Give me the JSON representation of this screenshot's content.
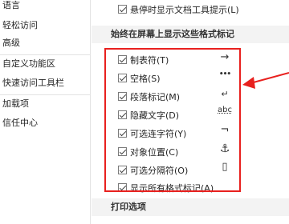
{
  "sidebar": {
    "items": [
      {
        "label": "语言"
      },
      {
        "label": "轻松访问"
      },
      {
        "label": "高级"
      },
      {
        "label": "自定义功能区"
      },
      {
        "label": "快速访问工具栏"
      },
      {
        "label": "加载项"
      },
      {
        "label": "信任中心"
      }
    ]
  },
  "main": {
    "top_option": {
      "label": "悬停时显示文档工具提示(L)",
      "checked": true
    },
    "formatting_section": {
      "title": "始终在屏幕上显示这些格式标记",
      "options": [
        {
          "label": "制表符(T)",
          "checked": true,
          "symbol": "→"
        },
        {
          "label": "空格(S)",
          "checked": true,
          "symbol": "•••"
        },
        {
          "label": "段落标记(M)",
          "checked": true,
          "symbol": "↵"
        },
        {
          "label": "隐藏文字(D)",
          "checked": true,
          "symbol": "abc"
        },
        {
          "label": "可选连字符(Y)",
          "checked": true,
          "symbol": "¬"
        },
        {
          "label": "对象位置(C)",
          "checked": true,
          "symbol": "⚓"
        },
        {
          "label": "可选分隔符(O)",
          "checked": true,
          "symbol": "▯"
        },
        {
          "label": "显示所有格式标记(A)",
          "checked": true,
          "symbol": ""
        }
      ]
    },
    "print_section": {
      "title": "打印选项"
    }
  },
  "annotation": {
    "highlight_color": "#e8201e"
  }
}
